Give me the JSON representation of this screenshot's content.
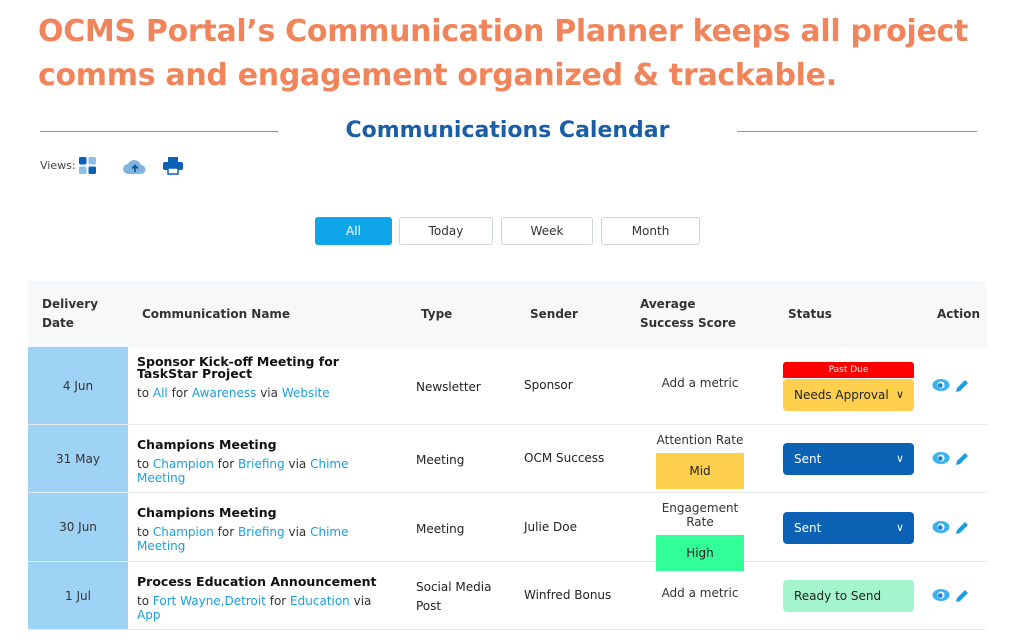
{
  "headline": "OCMS Portal’s Communication Planner keeps all project comms and engagement organized & trackable.",
  "calendar_title": "Communications Calendar",
  "views_label": "Views:",
  "toolbar_icons": [
    "grid-view-icon",
    "cloud-upload-icon",
    "print-icon"
  ],
  "filters": [
    {
      "label": "All",
      "active": true
    },
    {
      "label": "Today"
    },
    {
      "label": "Week"
    },
    {
      "label": "Month"
    }
  ],
  "columns": [
    "Delivery Date",
    "Communication Name",
    "Type",
    "Sender",
    "Average Success Score",
    "Status",
    "Action"
  ],
  "colors": {
    "accent": "#0ea5e9",
    "headline": "#f0845a",
    "date_cell": "#9fd3f5",
    "sent": "#0b62b5",
    "needs_approval": "#fed04e",
    "ready": "#a4f5cd",
    "past_due": "#ff0000",
    "mid": "#fed04e",
    "high": "#33ff99"
  },
  "rows": [
    {
      "date": "4 Jun",
      "name": "Sponsor Kick-off Meeting for TaskStar Project",
      "to": "to",
      "audience": "All",
      "for": "for",
      "purpose": "Awareness",
      "via": "via",
      "channel": "Website",
      "type": "Newsletter",
      "sender": "Sponsor",
      "score_label": "Add a metric",
      "score_value": "",
      "alert": "Past Due",
      "status": "Needs Approval"
    },
    {
      "date": "31 May",
      "name": "Champions Meeting",
      "to": "to",
      "audience": "Champion",
      "for": "for",
      "purpose": "Briefing",
      "via": "via",
      "channel": "Chime Meeting",
      "type": "Meeting",
      "sender": "OCM Success",
      "score_label": "Attention Rate",
      "score_value": "Mid",
      "status": "Sent"
    },
    {
      "date": "30 Jun",
      "name": "Champions Meeting",
      "to": "to",
      "audience": "Champion",
      "for": "for",
      "purpose": "Briefing",
      "via": "via",
      "channel": "Chime Meeting",
      "type": "Meeting",
      "sender": "Julie Doe",
      "score_label": "Engagement Rate",
      "score_value": "High",
      "status": "Sent"
    },
    {
      "date": "1 Jul",
      "name": "Process Education Announcement",
      "to": "to",
      "audience": "Fort Wayne,Detroit",
      "for": "for",
      "purpose": "Education",
      "via": "via",
      "channel": "App",
      "type": "Social Media Post",
      "sender": "Winfred Bonus",
      "score_label": "Add a metric",
      "score_value": "",
      "status": "Ready to Send"
    }
  ]
}
